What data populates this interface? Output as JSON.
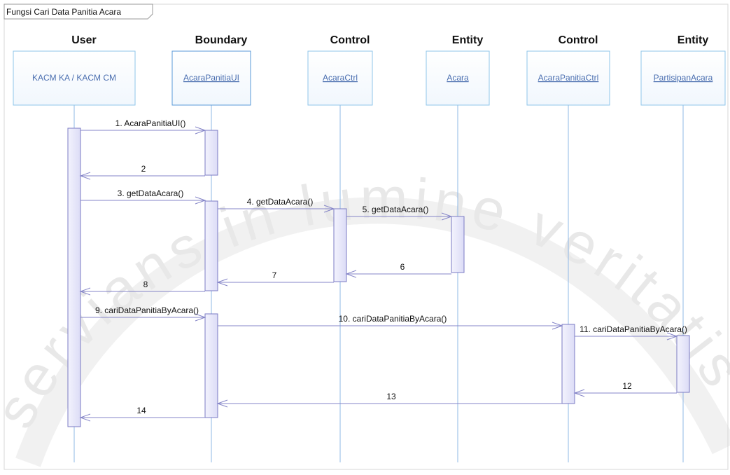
{
  "frame": {
    "label": "Fungsi Cari Data Panitia Acara"
  },
  "lifelines": [
    {
      "stereotype": "User",
      "name": "KACM KA / KACM CM",
      "underline": false
    },
    {
      "stereotype": "Boundary",
      "name": "AcaraPanitiaUI",
      "underline": true
    },
    {
      "stereotype": "Control",
      "name": "AcaraCtrl",
      "underline": true
    },
    {
      "stereotype": "Entity",
      "name": "Acara",
      "underline": true
    },
    {
      "stereotype": "Control",
      "name": "AcaraPanitiaCtrl",
      "underline": true
    },
    {
      "stereotype": "Entity",
      "name": "PartisipanAcara",
      "underline": true
    }
  ],
  "messages": [
    {
      "label": "1. AcaraPanitiaUI()",
      "from": 0,
      "to": 1,
      "kind": "call"
    },
    {
      "label": "2",
      "from": 1,
      "to": 0,
      "kind": "return"
    },
    {
      "label": "3. getDataAcara()",
      "from": 0,
      "to": 1,
      "kind": "call"
    },
    {
      "label": "4. getDataAcara()",
      "from": 1,
      "to": 2,
      "kind": "call"
    },
    {
      "label": "5. getDataAcara()",
      "from": 2,
      "to": 3,
      "kind": "call"
    },
    {
      "label": "6",
      "from": 3,
      "to": 2,
      "kind": "return"
    },
    {
      "label": "7",
      "from": 2,
      "to": 1,
      "kind": "return"
    },
    {
      "label": "8",
      "from": 1,
      "to": 0,
      "kind": "return"
    },
    {
      "label": "9. cariDataPanitiaByAcara()",
      "from": 0,
      "to": 1,
      "kind": "call"
    },
    {
      "label": "10. cariDataPanitiaByAcara()",
      "from": 1,
      "to": 4,
      "kind": "call"
    },
    {
      "label": "11. cariDataPanitiaByAcara()",
      "from": 4,
      "to": 5,
      "kind": "call"
    },
    {
      "label": "12",
      "from": 5,
      "to": 4,
      "kind": "return"
    },
    {
      "label": "13",
      "from": 4,
      "to": 1,
      "kind": "return"
    },
    {
      "label": "14",
      "from": 1,
      "to": 0,
      "kind": "return"
    }
  ],
  "watermark": {
    "text": "servians in lumine veritatis",
    "color": "#e6e6e6"
  },
  "colors": {
    "line": "#8585c8",
    "lifeline": "#8fb8e6",
    "box_border": "#8fc6ea",
    "activation_fill": "#e9e9fb",
    "activation_border": "#7b7bc4",
    "text": "#111111"
  }
}
